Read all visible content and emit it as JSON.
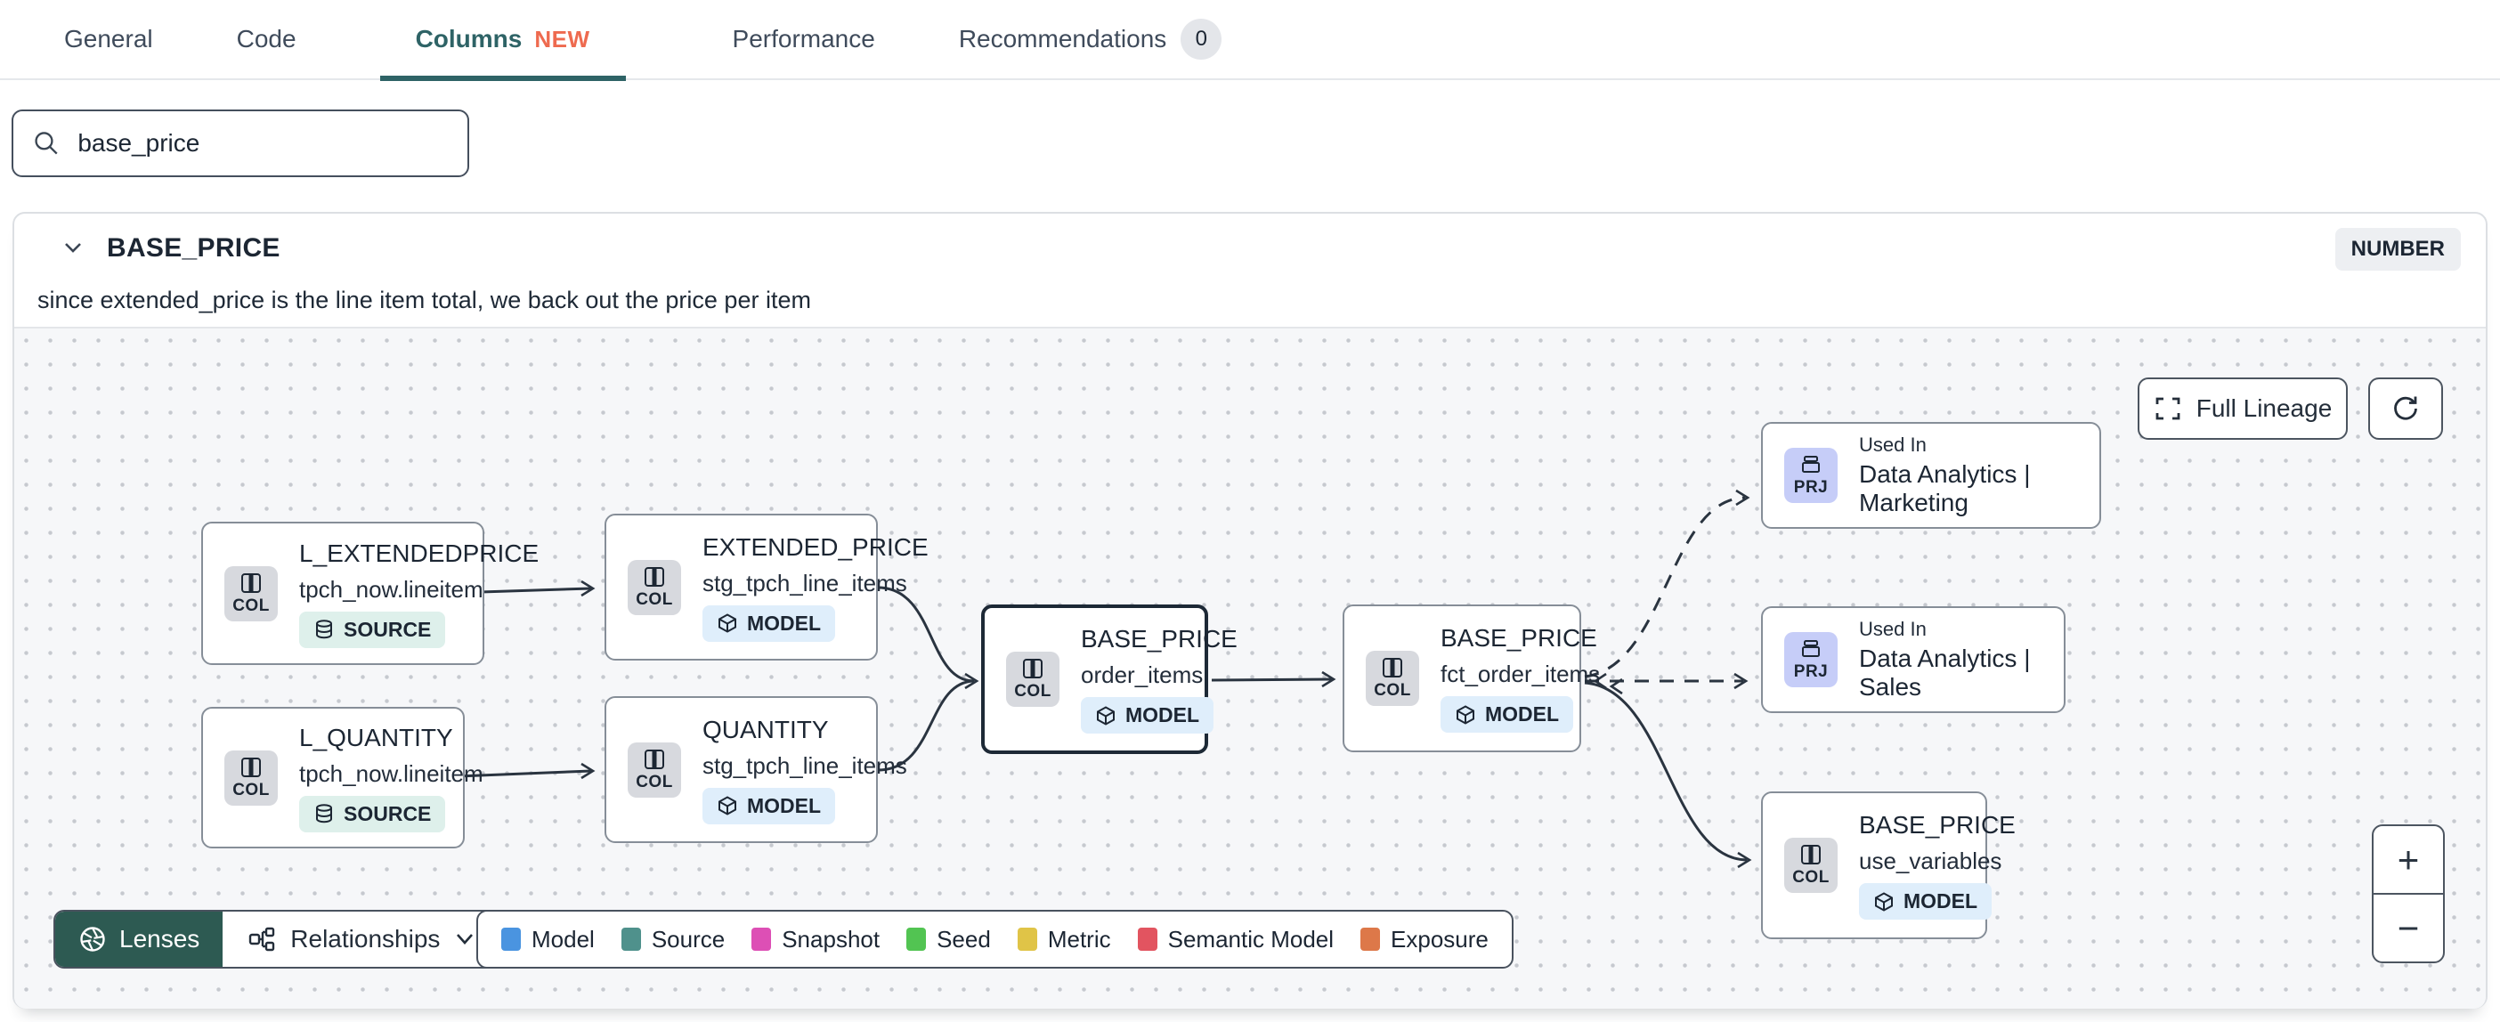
{
  "tabs": [
    {
      "label": "General"
    },
    {
      "label": "Code"
    },
    {
      "label": "Columns",
      "badge": "NEW",
      "active": true
    },
    {
      "label": "Performance"
    },
    {
      "label": "Recommendations",
      "count": "0"
    }
  ],
  "search": {
    "value": "base_price"
  },
  "column_card": {
    "title": "BASE_PRICE",
    "type_badge": "NUMBER",
    "description": "since extended_price is the line item total, we back out the price per item"
  },
  "labels": {
    "col": "COL",
    "prj": "PRJ",
    "used_in": "Used In"
  },
  "lineage": {
    "toolbar": {
      "full_lineage": "Full Lineage"
    },
    "zoom_in": "+",
    "zoom_out": "−",
    "lenses_label": "Lenses",
    "relationships_label": "Relationships",
    "nodes": [
      {
        "title": "L_EXTENDEDPRICE",
        "subtitle": "tpch_now.lineitem",
        "badge": "SOURCE"
      },
      {
        "title": "L_QUANTITY",
        "subtitle": "tpch_now.lineitem",
        "badge": "SOURCE"
      },
      {
        "title": "EXTENDED_PRICE",
        "subtitle": "stg_tpch_line_items",
        "badge": "MODEL"
      },
      {
        "title": "QUANTITY",
        "subtitle": "stg_tpch_line_items",
        "badge": "MODEL"
      },
      {
        "title": "BASE_PRICE",
        "subtitle": "order_items",
        "badge": "MODEL",
        "selected": true
      },
      {
        "title": "BASE_PRICE",
        "subtitle": "fct_order_items",
        "badge": "MODEL"
      },
      {
        "kind": "project",
        "label": "Used In",
        "title": "Data Analytics | Marketing"
      },
      {
        "kind": "project",
        "label": "Used In",
        "title": "Data Analytics | Sales"
      },
      {
        "title": "BASE_PRICE",
        "subtitle": "use_variables",
        "badge": "MODEL"
      }
    ],
    "legend": [
      {
        "label": "Model",
        "color": "#4a94e0"
      },
      {
        "label": "Source",
        "color": "#4f918c"
      },
      {
        "label": "Snapshot",
        "color": "#dd4fb5"
      },
      {
        "label": "Seed",
        "color": "#52c452"
      },
      {
        "label": "Metric",
        "color": "#e0c447"
      },
      {
        "label": "Semantic Model",
        "color": "#e25460"
      },
      {
        "label": "Exposure",
        "color": "#dd7849"
      }
    ],
    "accent_colors": {
      "active_tab": "#2e6366",
      "new_badge": "#ee6a4f",
      "lenses_bg": "#2d5a52"
    }
  }
}
